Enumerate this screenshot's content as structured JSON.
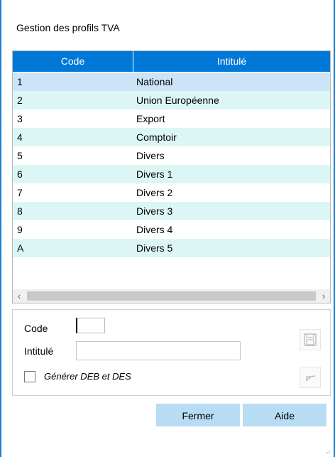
{
  "window": {
    "title": "Gestion des profils TVA"
  },
  "grid": {
    "columns": [
      "Code",
      "Intitulé"
    ],
    "rows": [
      {
        "code": "1",
        "label": "National"
      },
      {
        "code": "2",
        "label": "Union Européenne"
      },
      {
        "code": "3",
        "label": "Export"
      },
      {
        "code": "4",
        "label": "Comptoir"
      },
      {
        "code": "5",
        "label": "Divers"
      },
      {
        "code": "6",
        "label": "Divers 1"
      },
      {
        "code": "7",
        "label": "Divers 2"
      },
      {
        "code": "8",
        "label": "Divers 3"
      },
      {
        "code": "9",
        "label": "Divers 4"
      },
      {
        "code": "A",
        "label": "Divers 5"
      }
    ],
    "selected_index": 0
  },
  "form": {
    "code_label": "Code",
    "code_value": "",
    "intitule_label": "Intitulé",
    "intitule_value": "",
    "checkbox_label": "Générer DEB et DES",
    "checkbox_checked": false
  },
  "buttons": {
    "close": "Fermer",
    "help": "Aide"
  },
  "icons": {
    "save": "save-icon",
    "undo": "undo-icon"
  },
  "colors": {
    "accent": "#0078d7",
    "selected": "#cce4f7",
    "alt": "#dcf6f6",
    "button": "#b8dcf3"
  }
}
